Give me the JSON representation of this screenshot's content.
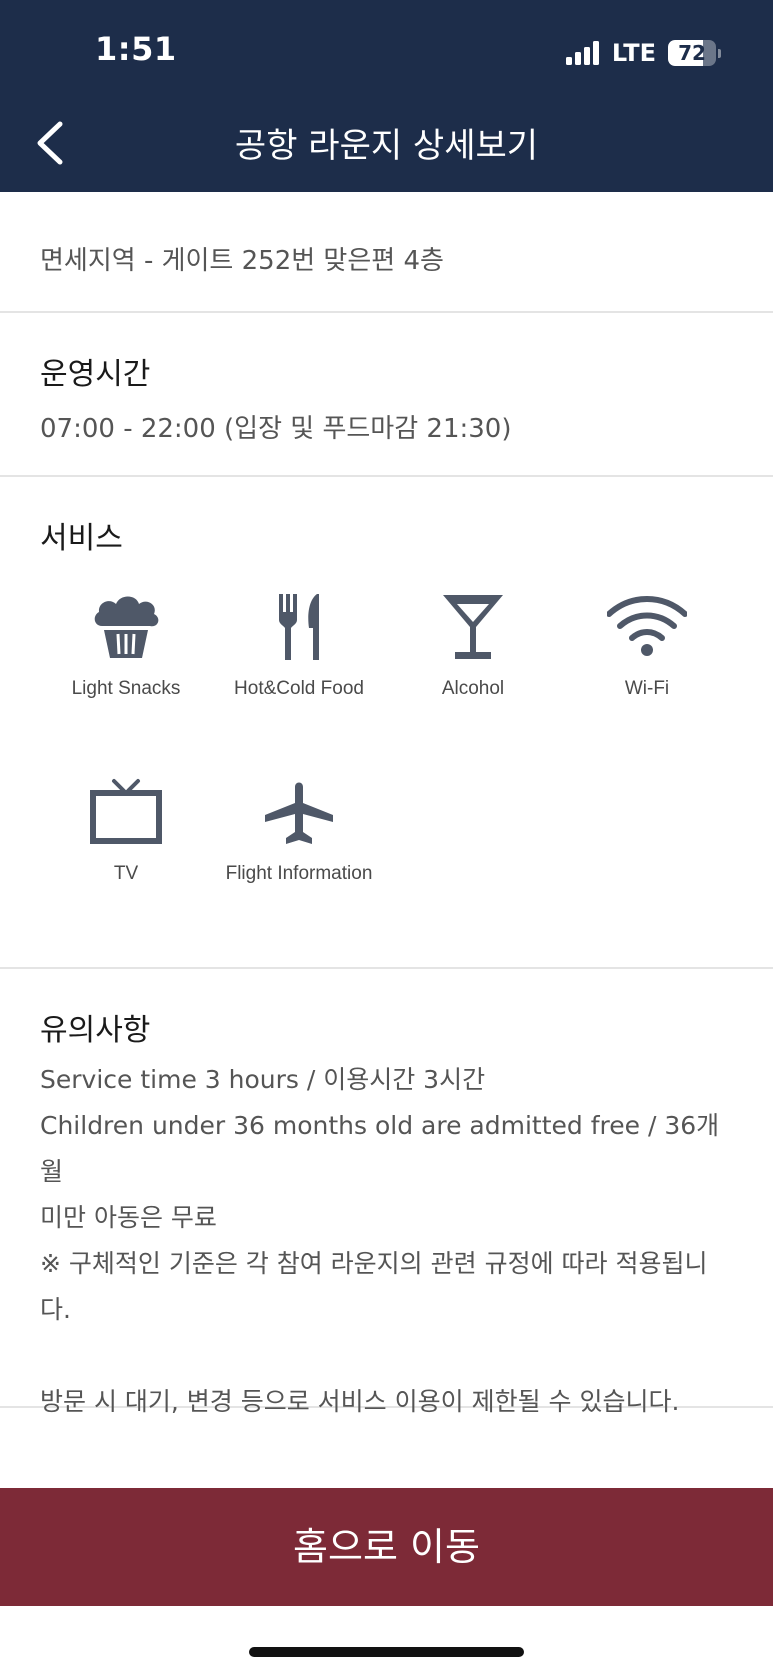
{
  "status_bar": {
    "time": "1:51",
    "network": "LTE",
    "battery": "72",
    "battery_level": 0.72
  },
  "header": {
    "title": "공항 라운지 상세보기",
    "back_icon": "chevron-left-icon"
  },
  "location": {
    "text": "면세지역 - 게이트 252번 맞은편 4층"
  },
  "hours": {
    "title": "운영시간",
    "text": "07:00 - 22:00 (입장 및 푸드마감 21:30)"
  },
  "services": {
    "title": "서비스",
    "items": [
      {
        "label": "Light Snacks",
        "icon": "cupcake-icon"
      },
      {
        "label": "Hot&Cold Food",
        "icon": "fork-knife-icon"
      },
      {
        "label": "Alcohol",
        "icon": "cocktail-icon"
      },
      {
        "label": "Wi-Fi",
        "icon": "wifi-icon"
      },
      {
        "label": "TV",
        "icon": "tv-icon"
      },
      {
        "label": "Flight Information",
        "icon": "airplane-icon"
      }
    ]
  },
  "notice": {
    "title": "유의사항",
    "lines": [
      "Service time 3 hours / 이용시간 3시간",
      "Children under 36 months old are admitted free / 36개월",
      "미만 아동은 무료",
      "※ 구체적인 기준은 각 참여 라운지의 관련 규정에 따라 적용됩니",
      "다.",
      "방문 시 대기, 변경 등으로 서비스 이용이 제한될 수 있습니다."
    ]
  },
  "footer": {
    "home_button_label": "홈으로 이동"
  },
  "colors": {
    "header_bg": "#1d2d4a",
    "button_bg": "#7d2a37",
    "icon": "#4f5868"
  }
}
